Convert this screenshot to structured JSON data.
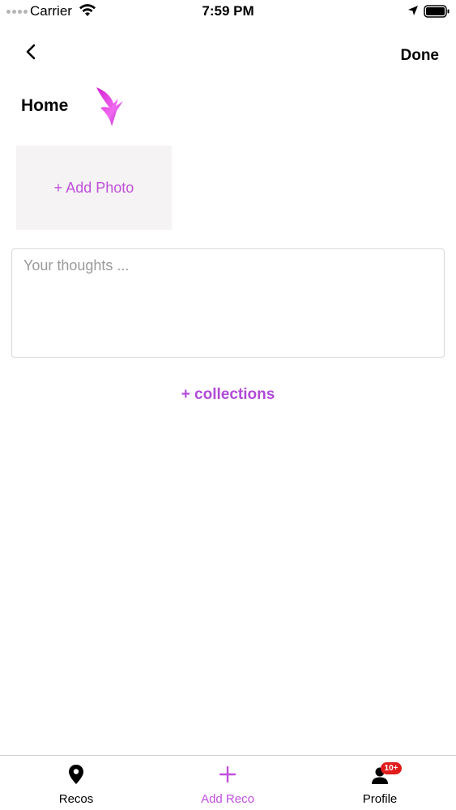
{
  "status_bar": {
    "carrier": "Carrier",
    "time": "7:59 PM"
  },
  "nav": {
    "done_label": "Done"
  },
  "page": {
    "title": "Home"
  },
  "add_photo": {
    "label": "+ Add Photo"
  },
  "thoughts": {
    "placeholder": "Your thoughts ...",
    "value": ""
  },
  "collections": {
    "label": "+ collections"
  },
  "tabs": [
    {
      "label": "Recos",
      "icon": "map-pin-icon"
    },
    {
      "label": "Add Reco",
      "icon": "plus-icon"
    },
    {
      "label": "Profile",
      "icon": "person-icon",
      "badge": "10+"
    }
  ],
  "colors": {
    "accent": "#c04fdc",
    "badge": "#e21b1b"
  }
}
